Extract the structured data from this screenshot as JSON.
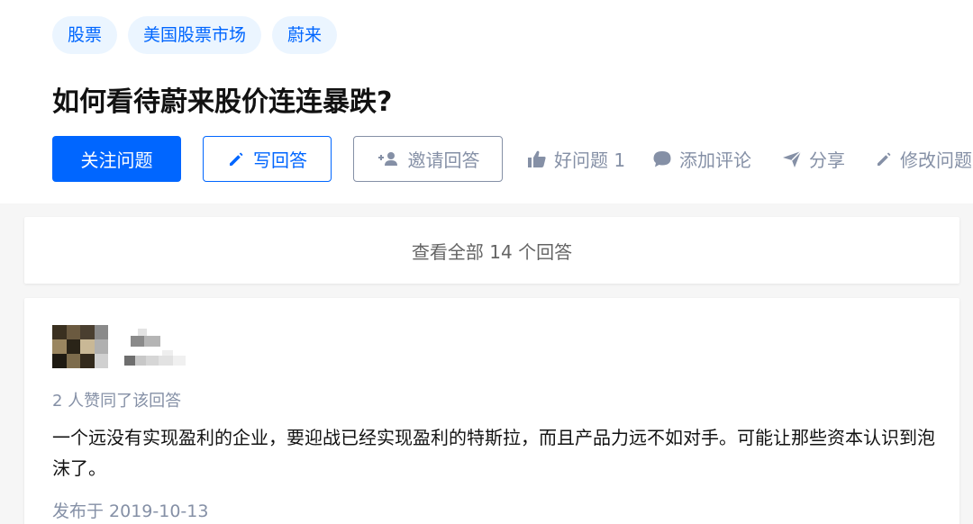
{
  "topics": [
    "股票",
    "美国股票市场",
    "蔚来"
  ],
  "question": {
    "title": "如何看待蔚来股价连连暴跌?"
  },
  "actions": {
    "follow_label": "关注问题",
    "write_answer_label": "写回答",
    "invite_label": "邀请回答",
    "good_question_label": "好问题 1",
    "comment_label": "添加评论",
    "share_label": "分享",
    "edit_label": "修改问题"
  },
  "view_all_answers": "查看全部 14 个回答",
  "answer": {
    "voters_text": "2 人赞同了该回答",
    "content": "一个远没有实现盈利的企业，要迎战已经实现盈利的特斯拉，而且产品力远不如对手。可能让那些资本认识到泡沫了。",
    "published": "发布于 2019-10-13"
  },
  "colors": {
    "brand_blue": "#0066ff",
    "tag_background": "#ebf5ff",
    "muted_gray": "#8590a6",
    "page_background": "#f6f6f6"
  },
  "icons": {
    "write_answer": "pencil-icon",
    "invite": "add-person-icon",
    "good_question": "thumbs-up-icon",
    "comment": "speech-bubble-icon",
    "share": "paper-plane-icon",
    "edit": "pencil-icon"
  }
}
